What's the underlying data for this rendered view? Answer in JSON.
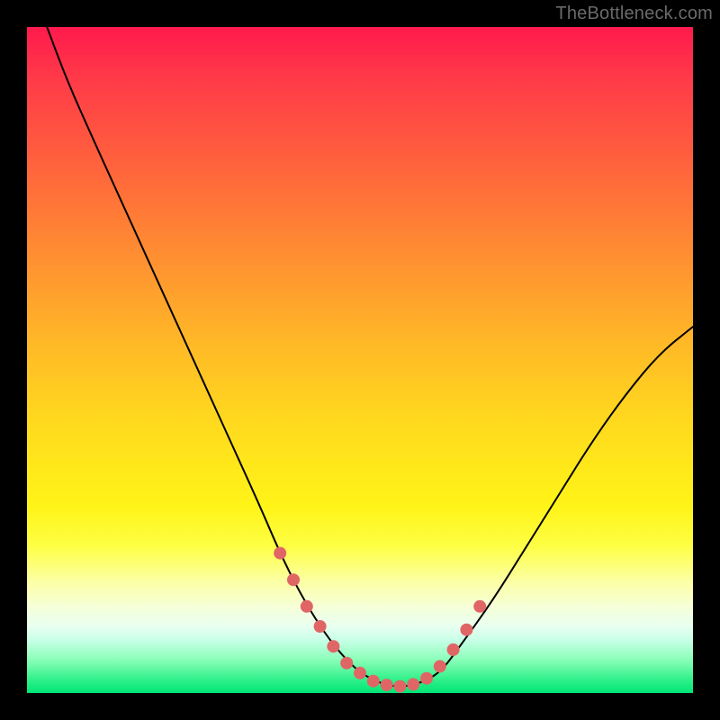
{
  "attribution": "TheBottleneck.com",
  "colors": {
    "frame": "#000000",
    "curve": "#000000",
    "marker_fill": "#e06666",
    "marker_stroke": "#cc4d4d",
    "gradient_stops": [
      "#ff1a4d",
      "#ff7a36",
      "#ffd61f",
      "#feff45",
      "#f6ffd8",
      "#30f08a",
      "#00e676"
    ]
  },
  "chart_data": {
    "type": "line",
    "title": "",
    "xlabel": "",
    "ylabel": "",
    "xlim": [
      0,
      100
    ],
    "ylim": [
      0,
      100
    ],
    "grid": false,
    "series": [
      {
        "name": "bottleneck-curve",
        "x": [
          3,
          6,
          10,
          15,
          20,
          25,
          30,
          35,
          38,
          41,
          44,
          47,
          50,
          53,
          55,
          57,
          59,
          62,
          65,
          70,
          75,
          80,
          85,
          90,
          95,
          100
        ],
        "y": [
          100,
          92,
          83,
          72,
          61,
          50,
          39,
          28,
          21,
          15,
          10,
          6,
          3,
          1.5,
          1,
          1,
          1.5,
          3,
          7,
          14,
          22,
          30,
          38,
          45,
          51,
          55
        ]
      }
    ],
    "markers": {
      "name": "highlighted-range",
      "x": [
        38,
        40,
        42,
        44,
        46,
        48,
        50,
        52,
        54,
        56,
        58,
        60,
        62,
        64,
        66,
        68
      ],
      "y": [
        21,
        17,
        13,
        10,
        7,
        4.5,
        3,
        1.8,
        1.2,
        1,
        1.3,
        2.2,
        4,
        6.5,
        9.5,
        13
      ],
      "radius": 7
    }
  }
}
